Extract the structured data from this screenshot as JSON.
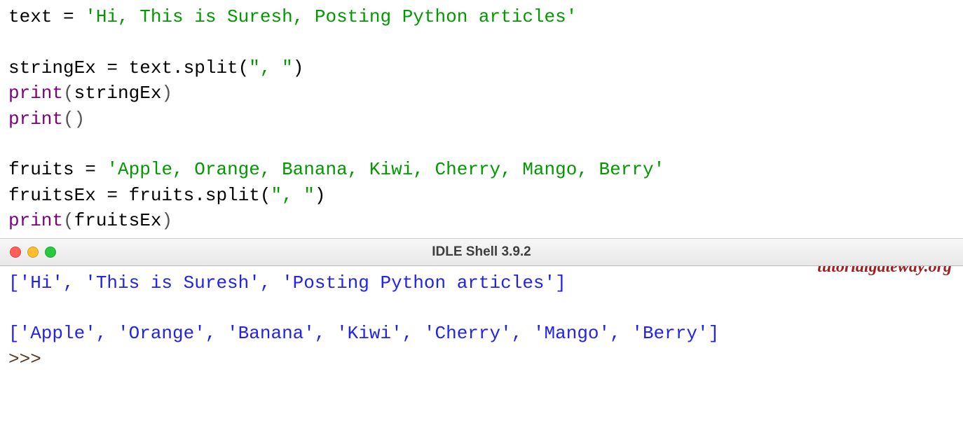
{
  "code": {
    "l1": {
      "p1": "text = ",
      "p2": "'Hi, This is Suresh, Posting Python articles'"
    },
    "blank": " ",
    "l2": {
      "p1": "stringEx = text.split(",
      "p2": "\", \"",
      "p3": ")"
    },
    "l3": {
      "p1": "print",
      "p2": "(",
      "p3": "stringEx",
      "p4": ")"
    },
    "l4": {
      "p1": "print",
      "p2": "(",
      "p3": ")"
    },
    "l5": {
      "p1": "fruits = ",
      "p2": "'Apple, Orange, Banana, Kiwi, Cherry, Mango, Berry'"
    },
    "l6": {
      "p1": "fruitsEx = fruits.split(",
      "p2": "\", \"",
      "p3": ")"
    },
    "l7": {
      "p1": "print",
      "p2": "(",
      "p3": "fruitsEx",
      "p4": ")"
    }
  },
  "watermark": "tutorialgateway.org",
  "titlebar": {
    "title": "IDLE Shell 3.9.2"
  },
  "output": {
    "l1": "['Hi', 'This is Suresh', 'Posting Python articles']",
    "l2": "['Apple', 'Orange', 'Banana', 'Kiwi', 'Cherry', 'Mango', 'Berry']",
    "prompt": ">>> "
  }
}
